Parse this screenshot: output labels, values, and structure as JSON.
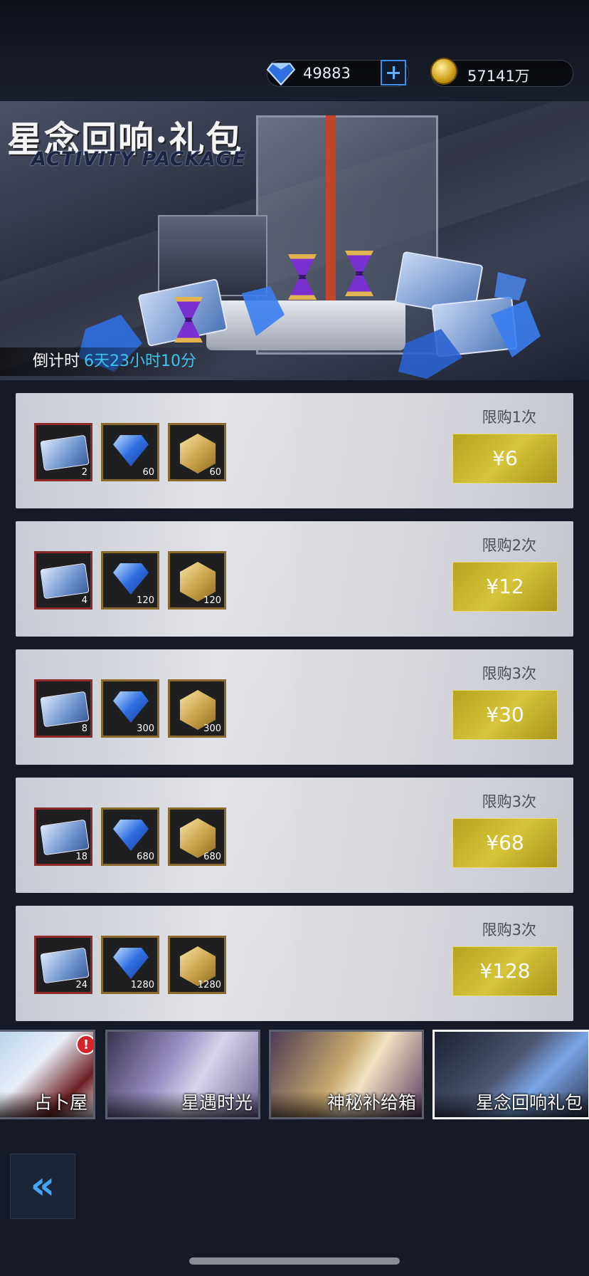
{
  "currency": {
    "gems": "49883",
    "gold": "57141万"
  },
  "banner": {
    "title_cn": "星念回响·礼包",
    "title_en": "ACTIVITY PACKAGE",
    "countdown_label": "倒计时",
    "countdown_value": "6天23小时10分"
  },
  "packages": [
    {
      "limit": "限购1次",
      "price": "¥6",
      "items": [
        {
          "qty": "2"
        },
        {
          "qty": "60"
        },
        {
          "qty": "60"
        }
      ]
    },
    {
      "limit": "限购2次",
      "price": "¥12",
      "items": [
        {
          "qty": "4"
        },
        {
          "qty": "120"
        },
        {
          "qty": "120"
        }
      ]
    },
    {
      "limit": "限购3次",
      "price": "¥30",
      "items": [
        {
          "qty": "8"
        },
        {
          "qty": "300"
        },
        {
          "qty": "300"
        }
      ]
    },
    {
      "limit": "限购3次",
      "price": "¥68",
      "items": [
        {
          "qty": "18"
        },
        {
          "qty": "680"
        },
        {
          "qty": "680"
        }
      ]
    },
    {
      "limit": "限购3次",
      "price": "¥128",
      "items": [
        {
          "qty": "24"
        },
        {
          "qty": "1280"
        },
        {
          "qty": "1280"
        }
      ]
    }
  ],
  "tabs": [
    {
      "label": "占卜屋",
      "alert": "!"
    },
    {
      "label": "星遇时光"
    },
    {
      "label": "神秘补给箱"
    },
    {
      "label": "星念回响礼包",
      "active": true
    }
  ],
  "colors": {
    "price_gold": "#c9b42a",
    "countdown_cyan": "#3dc4ee",
    "back_arrow_blue": "#42a5f5"
  }
}
